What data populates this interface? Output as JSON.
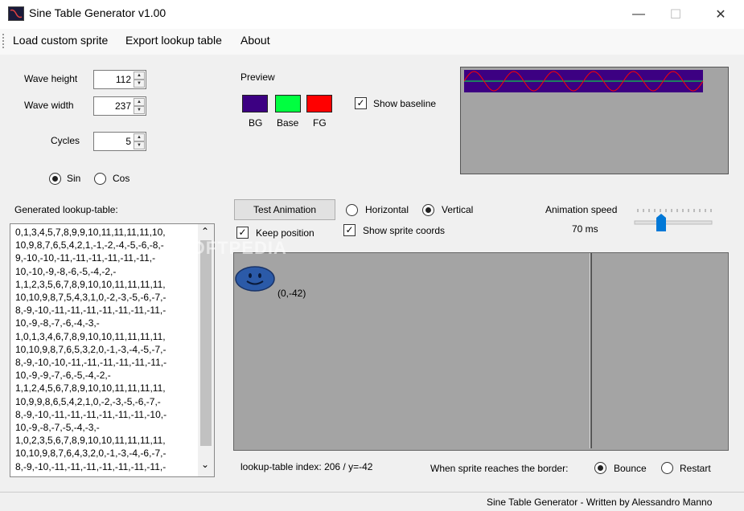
{
  "window": {
    "title": "Sine Table Generator v1.00",
    "minimize": "—",
    "maximize": "☐",
    "close": "✕"
  },
  "menu": [
    "Load custom sprite",
    "Export lookup table",
    "About"
  ],
  "params": {
    "wave_height_label": "Wave height",
    "wave_height": "112",
    "wave_width_label": "Wave width",
    "wave_width": "237",
    "cycles_label": "Cycles",
    "cycles": "5",
    "sin_label": "Sin",
    "cos_label": "Cos",
    "selected": "Sin"
  },
  "preview": {
    "label": "Preview",
    "bg_label": "BG",
    "base_label": "Base",
    "fg_label": "FG",
    "bg_color": "#3c0082",
    "base_color": "#00ff40",
    "fg_color": "#ff0000",
    "show_baseline_label": "Show baseline",
    "show_baseline": true
  },
  "lookup": {
    "label": "Generated lookup-table:",
    "lines": [
      "0,1,3,4,5,7,8,9,9,10,11,11,11,11,10,",
      "10,9,8,7,6,5,4,2,1,-1,-2,-4,-5,-6,-8,-",
      "9,-10,-10,-11,-11,-11,-11,-11,-11,-",
      "10,-10,-9,-8,-6,-5,-4,-2,-",
      "1,1,2,3,5,6,7,8,9,10,10,11,11,11,11,",
      "10,10,9,8,7,5,4,3,1,0,-2,-3,-5,-6,-7,-",
      "8,-9,-10,-11,-11,-11,-11,-11,-11,-11,-",
      "10,-9,-8,-7,-6,-4,-3,-",
      "1,0,1,3,4,6,7,8,9,10,10,11,11,11,11,",
      "10,10,9,8,7,6,5,3,2,0,-1,-3,-4,-5,-7,-",
      "8,-9,-10,-10,-11,-11,-11,-11,-11,-11,-",
      "10,-9,-9,-7,-6,-5,-4,-2,-",
      "1,1,2,4,5,6,7,8,9,10,10,11,11,11,11,",
      "10,9,9,8,6,5,4,2,1,0,-2,-3,-5,-6,-7,-",
      "8,-9,-10,-11,-11,-11,-11,-11,-11,-10,-",
      "10,-9,-8,-7,-5,-4,-3,-",
      "1,0,2,3,5,6,7,8,9,10,10,11,11,11,11,",
      "10,10,9,8,7,6,4,3,2,0,-1,-3,-4,-6,-7,-",
      "8,-9,-10,-11,-11,-11,-11,-11,-11,-11,-"
    ]
  },
  "animation": {
    "test_button": "Test Animation",
    "horizontal_label": "Horizontal",
    "vertical_label": "Vertical",
    "direction": "Vertical",
    "keep_position_label": "Keep position",
    "keep_position": true,
    "show_coords_label": "Show sprite coords",
    "show_coords": true,
    "speed_label": "Animation speed",
    "speed_value": "70 ms",
    "sprite_coords": "(0,-42)",
    "index_text": "lookup-table index: 206 / y=-42",
    "border_label": "When sprite reaches the border:",
    "bounce_label": "Bounce",
    "restart_label": "Restart",
    "border_mode": "Bounce"
  },
  "status": "Sine Table Generator - Written by Alessandro Manno",
  "watermark": "SOFTPEDIA",
  "icons": {
    "spin_up": "▲",
    "spin_down": "▼",
    "check": "✓",
    "scroll_up": "⌃",
    "scroll_down": "⌄"
  }
}
